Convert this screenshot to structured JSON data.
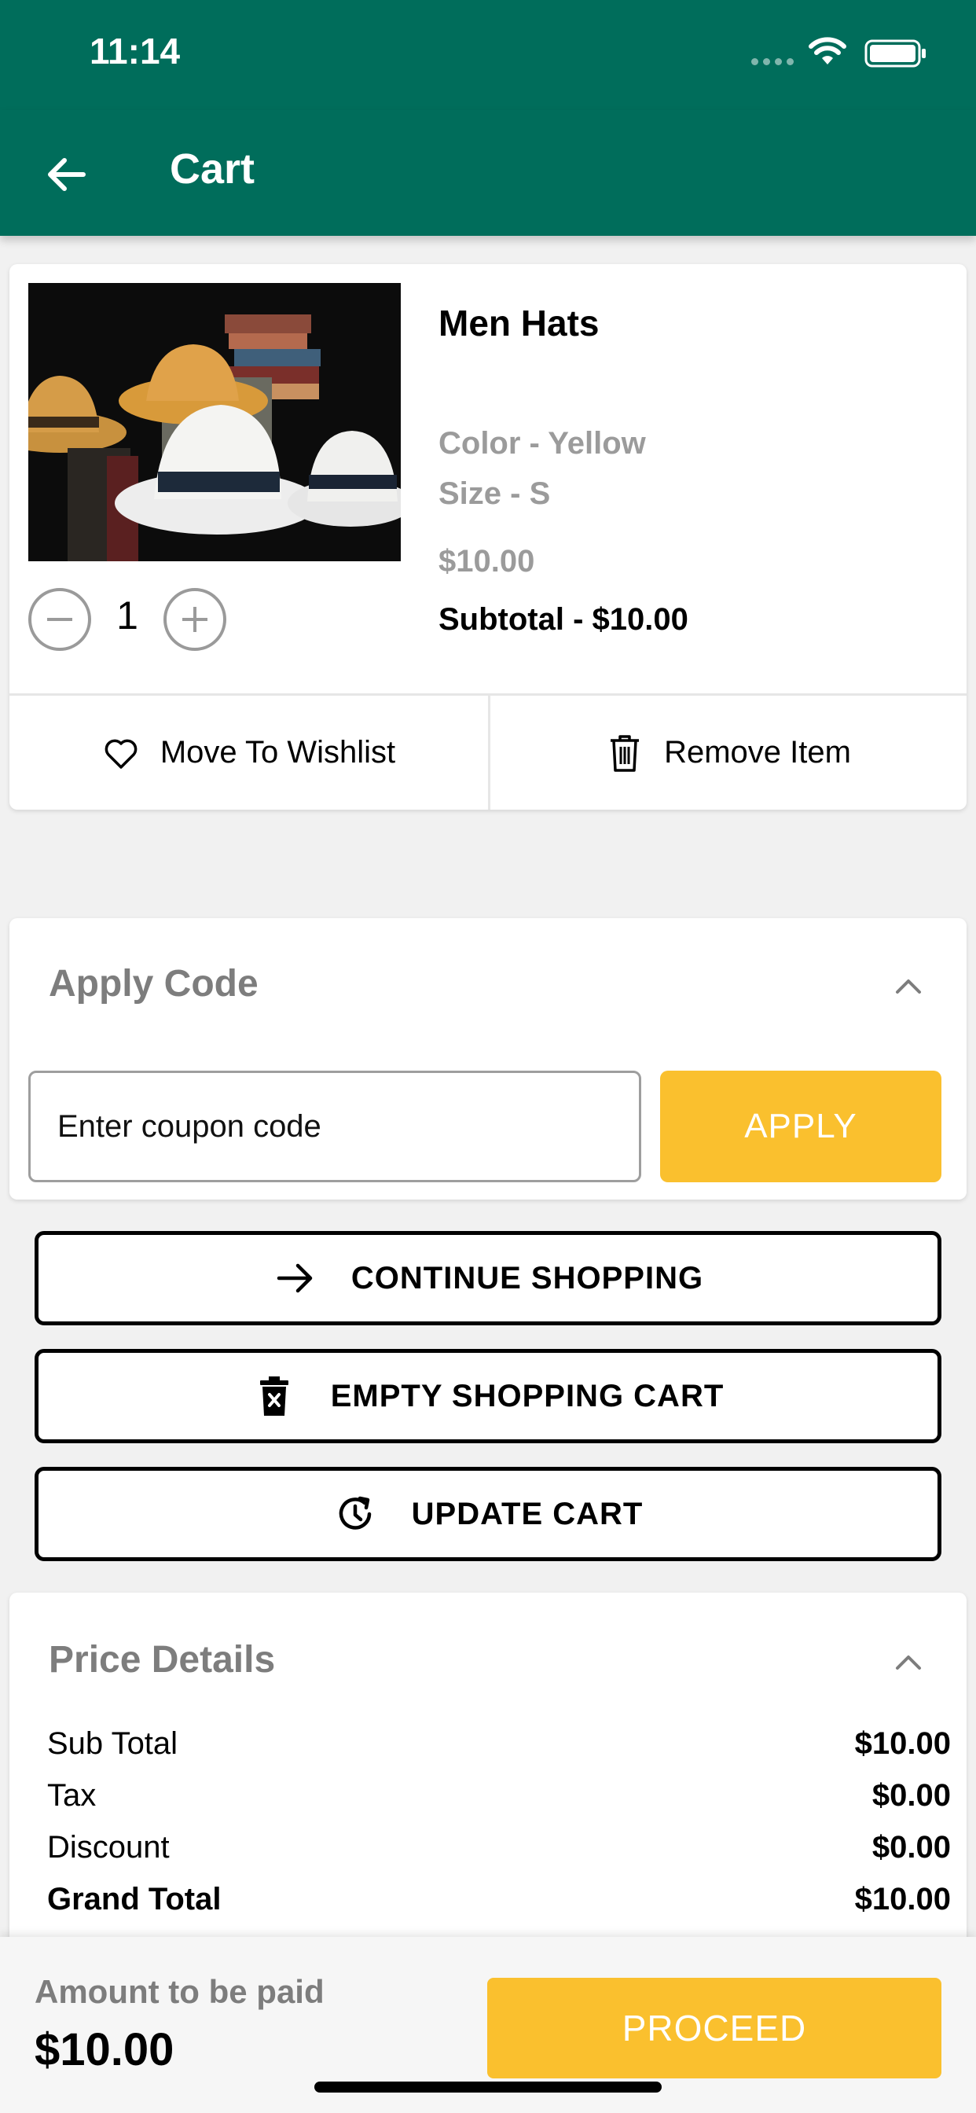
{
  "status_bar": {
    "time": "11:14"
  },
  "app_bar": {
    "title": "Cart"
  },
  "cart_item": {
    "name": "Men Hats",
    "color": "Color - Yellow",
    "size": "Size - S",
    "price": "$10.00",
    "subtotal": "Subtotal - $10.00",
    "quantity": "1",
    "wishlist_label": "Move To Wishlist",
    "remove_label": "Remove Item"
  },
  "coupon": {
    "title": "Apply Code",
    "placeholder": "Enter coupon code",
    "apply_label": "APPLY"
  },
  "actions": {
    "continue_label": "CONTINUE SHOPPING",
    "empty_label": "EMPTY SHOPPING CART",
    "update_label": "UPDATE CART"
  },
  "price_details": {
    "title": "Price Details",
    "rows": [
      {
        "label": "Sub Total",
        "value": "$10.00"
      },
      {
        "label": "Tax",
        "value": "$0.00"
      },
      {
        "label": "Discount",
        "value": "$0.00"
      },
      {
        "label": "Grand Total",
        "value": "$10.00"
      }
    ]
  },
  "footer": {
    "amount_label": "Amount to be paid",
    "amount_value": "$10.00",
    "proceed_label": "PROCEED"
  },
  "colors": {
    "primary": "#006d5b",
    "accent": "#fac02e"
  },
  "icons": [
    "arrow-left-icon",
    "wifi-icon",
    "battery-icon",
    "heart-icon",
    "trash-icon",
    "chevron-up-icon",
    "arrow-right-icon",
    "trash-x-icon",
    "refresh-clock-icon",
    "minus-icon",
    "plus-icon"
  ]
}
